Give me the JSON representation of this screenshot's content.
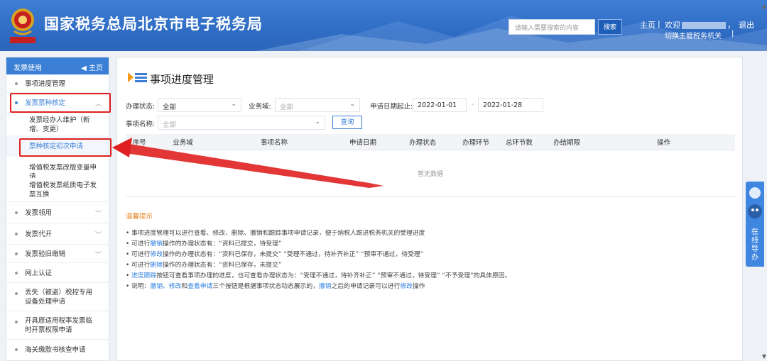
{
  "header": {
    "site_title": "国家税务总局北京市电子税务局",
    "search_placeholder": "请输入需要搜索的内容",
    "search_button": "搜索",
    "home_link": "主页",
    "separator": "|",
    "welcome_prefix": "欢迎",
    "welcome_suffix": "，",
    "logout": "退出",
    "switch_org": "切换主管税务机关",
    "switch_sep": "|",
    "emblem_caption": "中国税务"
  },
  "sidebar": {
    "header_title": "发票使用",
    "home_label": "主页",
    "items": [
      {
        "label": "事项进度管理"
      },
      {
        "label": "发票票种核定",
        "expanded": true
      },
      {
        "label": "发票领用"
      },
      {
        "label": "发票代开"
      },
      {
        "label": "发票验旧缴销"
      },
      {
        "label": "网上认证"
      },
      {
        "label": "丢失（被盗）税控专用设备处理申请"
      },
      {
        "label": "开具原适用税率发票临时开票权限申请"
      },
      {
        "label": "海关缴款书核查申请"
      }
    ],
    "sub_items": [
      {
        "label": "发票经办人维护（新增、变更）"
      },
      {
        "label": "票种核定初次申请",
        "active": true
      },
      {
        "label": "增值税发票改版变量申请"
      },
      {
        "label": "增值税发票纸质电子发票互换"
      }
    ]
  },
  "main": {
    "title": "事项进度管理",
    "form": {
      "status_label": "办理状态:",
      "status_value": "全部",
      "domain_label": "业务域:",
      "domain_value": "全部",
      "date_label": "申请日期起止:",
      "date_from": "2022-01-01",
      "date_sep": "-",
      "date_to": "2022-01-28",
      "name_label": "事项名称:",
      "name_value": "全部",
      "query_button": "查询"
    },
    "table": {
      "columns": [
        "序号",
        "业务域",
        "事项名称",
        "申请日期",
        "办理状态",
        "办理环节",
        "总环节数",
        "办结期限",
        "操作"
      ],
      "empty_text": "暂无数据"
    },
    "tips": {
      "title": "温馨提示",
      "lines": [
        {
          "parts": [
            "• 事项进度管理可以进行查看、修改、删除、撤销和跟踪事项申请记录，便于纳税人跟进税务机关的受理进度"
          ]
        },
        {
          "parts": [
            "• 可进行",
            "撤销",
            "操作的办理状态有：“资料已提交，待受理”"
          ]
        },
        {
          "parts": [
            "• 可进行",
            "修改",
            "操作的办理状态有：“资料已保存，未提交”  “受理不通过，待补齐补正”  “预审不通过，待受理”"
          ]
        },
        {
          "parts": [
            "• 可进行",
            "删除",
            "操作的办理状态有：“资料已保存，未提交”"
          ]
        },
        {
          "parts": [
            "• ",
            "进度跟踪",
            "按钮可查看事项办理的进度，也可查看办理状态为：“受理不通过，待补齐补正”  “预审不通过，待受理”  “不予受理”的具体原因。"
          ]
        },
        {
          "parts": [
            "• 说明：",
            "撤销、修改",
            "和",
            "查看申请",
            "三个按钮是根据事项状态动态展示的，",
            "撤销",
            "之后的申请记录可以进行",
            "修改",
            "操作"
          ]
        }
      ]
    }
  },
  "float_tab": {
    "label": "在线导办"
  },
  "colors": {
    "header_blue": "#2f6cc4",
    "accent": "#3a7fd5",
    "highlight_red": "#e02020",
    "tip_orange": "#e6801a",
    "link_blue": "#2a7de1"
  }
}
